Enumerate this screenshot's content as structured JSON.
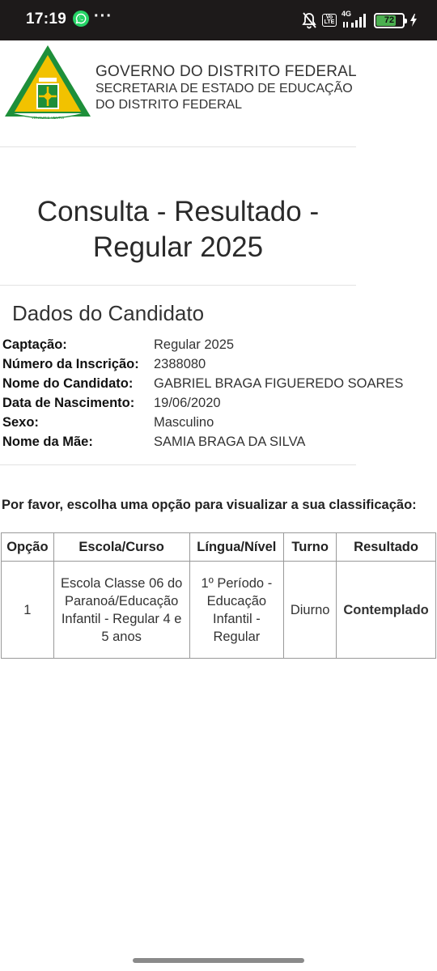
{
  "status_bar": {
    "time": "17:19",
    "icons": [
      "whatsapp-icon",
      "more-dots-icon",
      "bell-off-icon",
      "volte-icon",
      "signal-icon",
      "battery-icon",
      "charging-bolt-icon"
    ],
    "more": "···",
    "volte": "Vo LTE",
    "network": "4G",
    "battery_level": "72",
    "battery_fraction": 0.72
  },
  "header": {
    "logo_text": "VENTURIS VENTIS",
    "title": "GOVERNO DO DISTRITO FEDERAL",
    "subtitle_lines": [
      "SECRETARIA DE ESTADO DE EDUCAÇÃO",
      "DO DISTRITO FEDERAL"
    ]
  },
  "page_title": "Consulta - Resultado - Regular 2025",
  "candidate": {
    "section_title": "Dados do Candidato",
    "fields": [
      {
        "label": "Captação:",
        "value": "Regular 2025"
      },
      {
        "label": "Número da Inscrição:",
        "value": "2388080"
      },
      {
        "label": "Nome do Candidato:",
        "value": "GABRIEL BRAGA FIGUEREDO SOARES"
      },
      {
        "label": "Data de Nascimento:",
        "value": "19/06/2020"
      },
      {
        "label": "Sexo:",
        "value": "Masculino"
      },
      {
        "label": "Nome da Mãe:",
        "value": "SAMIA BRAGA DA SILVA"
      }
    ]
  },
  "instruction": "Por favor, escolha uma opção para visualizar a sua classificação:",
  "results_table": {
    "headers": [
      "Opção",
      "Escola/Curso",
      "Língua/Nível",
      "Turno",
      "Resultado"
    ],
    "rows": [
      {
        "opcao": "1",
        "escola": "Escola Classe 06 do Paranoá/Educação Infantil - Regular 4 e 5 anos",
        "lingua": "1º Período - Educação Infantil - Regular",
        "turno": "Diurno",
        "resultado": "Contemplado"
      }
    ]
  },
  "colors": {
    "status_bar_bg": "#1d1a1a",
    "logo_green": "#1e8f3a",
    "logo_yellow": "#f2c200",
    "battery_green": "#4caf50"
  }
}
